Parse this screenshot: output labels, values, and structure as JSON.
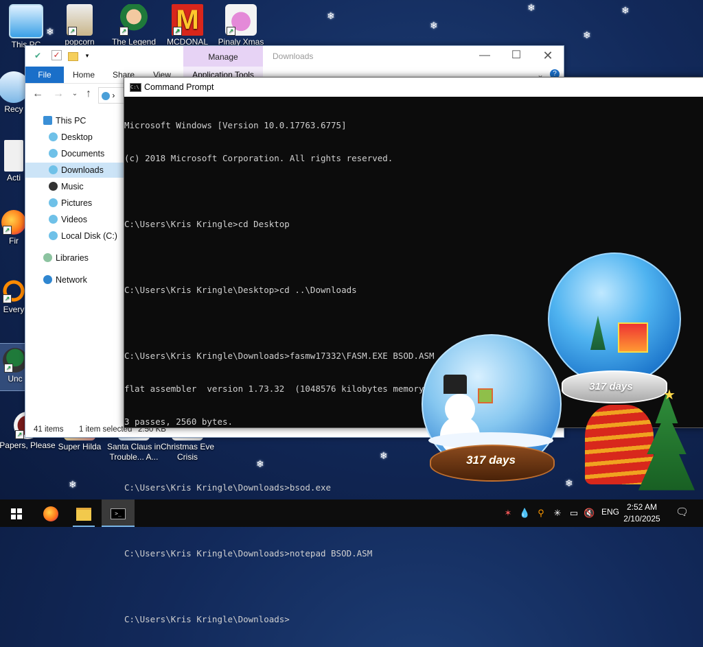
{
  "desktop_icons": [
    {
      "label": "This PC"
    },
    {
      "label": "popcorn"
    },
    {
      "label": "The Legend"
    },
    {
      "label": "MCDONAL"
    },
    {
      "label": "Pinaly Xmas"
    },
    {
      "label": "Recy"
    },
    {
      "label": "Acti"
    },
    {
      "label": "Fir"
    },
    {
      "label": "Every"
    },
    {
      "label": "Unc"
    },
    {
      "label": "Papers, Please"
    },
    {
      "label": "Super Hilda"
    },
    {
      "label": "Santa Claus in Trouble... A..."
    },
    {
      "label": "Christmas Eve Crisis"
    }
  ],
  "explorer": {
    "manage_label": "Manage",
    "title": "Downloads",
    "tabs": {
      "file": "File",
      "home": "Home",
      "share": "Share",
      "view": "View",
      "app_tools": "Application Tools"
    },
    "nav_items": [
      {
        "label": "This PC"
      },
      {
        "label": "Desktop"
      },
      {
        "label": "Documents"
      },
      {
        "label": "Downloads"
      },
      {
        "label": "Music"
      },
      {
        "label": "Pictures"
      },
      {
        "label": "Videos"
      },
      {
        "label": "Local Disk (C:)"
      },
      {
        "label": "Libraries"
      },
      {
        "label": "Network"
      }
    ],
    "status": {
      "items": "41 items",
      "selected": "1 item selected",
      "size": "2.50 KB"
    }
  },
  "cmd": {
    "title": "Command Prompt",
    "lines": [
      "Microsoft Windows [Version 10.0.17763.6775]",
      "(c) 2018 Microsoft Corporation. All rights reserved.",
      "",
      "C:\\Users\\Kris Kringle>cd Desktop",
      "",
      "C:\\Users\\Kris Kringle\\Desktop>cd ..\\Downloads",
      "",
      "C:\\Users\\Kris Kringle\\Downloads>fasmw17332\\FASM.EXE BSOD.ASM",
      "flat assembler  version 1.73.32  (1048576 kilobytes memory)",
      "3 passes, 2560 bytes.",
      "",
      "C:\\Users\\Kris Kringle\\Downloads>bsod.exe",
      "",
      "C:\\Users\\Kris Kringle\\Downloads>notepad BSOD.ASM",
      "",
      "C:\\Users\\Kris Kringle\\Downloads>"
    ]
  },
  "globes": {
    "badge_left": "317 days",
    "badge_right": "317 days"
  },
  "taskbar": {
    "lang": "ENG",
    "time": "2:52 AM",
    "date": "2/10/2025"
  },
  "colors": {
    "file_tab": "#1a6fc9",
    "manage_tab": "#e7d3f5",
    "selected_nav": "#cce4f7",
    "cmd_bg": "#0c0c0c"
  }
}
